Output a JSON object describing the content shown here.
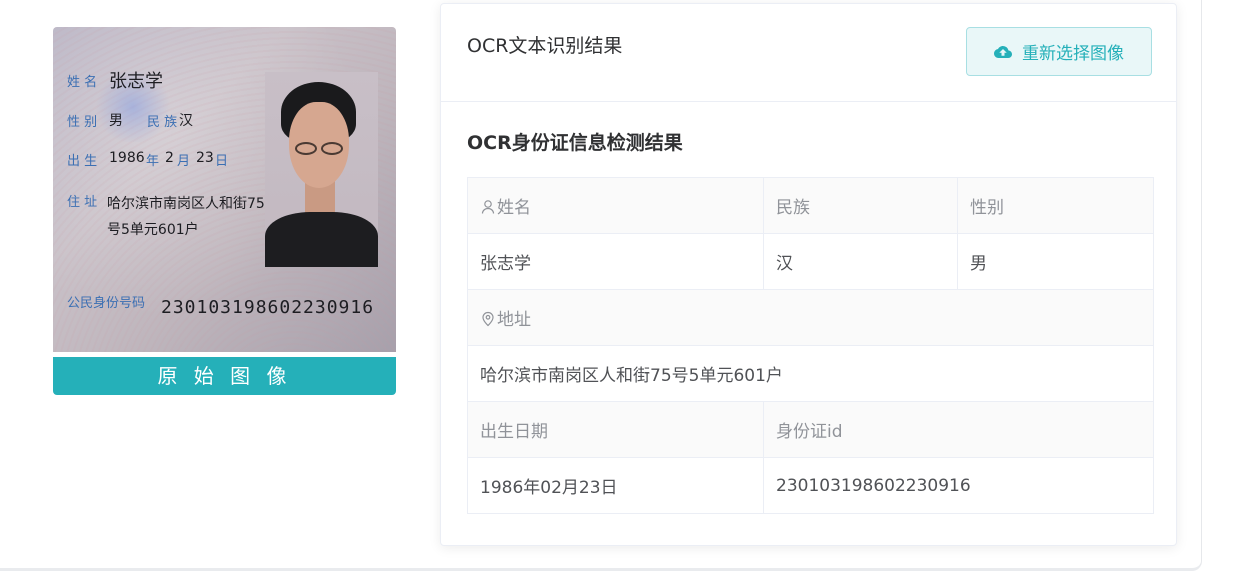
{
  "id_card": {
    "name_label": "姓 名",
    "name_value": "张志学",
    "gender_label": "性 别",
    "gender_value": "男",
    "ethnicity_label": "民 族",
    "ethnicity_value": "汉",
    "birth_label": "出 生",
    "birth_year": "1986",
    "birth_year_unit": "年",
    "birth_month": "2",
    "birth_month_unit": "月",
    "birth_day": "23",
    "birth_day_unit": "日",
    "address_label": "住 址",
    "address_line1": "哈尔滨市南岗区人和街75",
    "address_line2": "号5单元601户",
    "id_label": "公民身份号码",
    "id_value": "230103198602230916"
  },
  "photo_caption": "原 始 图 像",
  "card": {
    "title": "OCR文本识别结果",
    "reselect_button": "重新选择图像",
    "section_title": "OCR身份证信息检测结果"
  },
  "table": {
    "name_header": "姓名",
    "ethnicity_header": "民族",
    "gender_header": "性别",
    "name_value": "张志学",
    "ethnicity_value": "汉",
    "gender_value": "男",
    "address_header": "地址",
    "address_value": "哈尔滨市南岗区人和街75号5单元601户",
    "birth_header": "出生日期",
    "id_header": "身份证id",
    "birth_value": "1986年02月23日",
    "id_value": "230103198602230916"
  },
  "colors": {
    "accent": "#25b0b9",
    "button_bg": "#e9f7f8",
    "header_cell_bg": "#fafafa"
  },
  "icons": {
    "upload": "cloud-upload-icon",
    "user": "user-icon",
    "location": "location-pin-icon"
  }
}
